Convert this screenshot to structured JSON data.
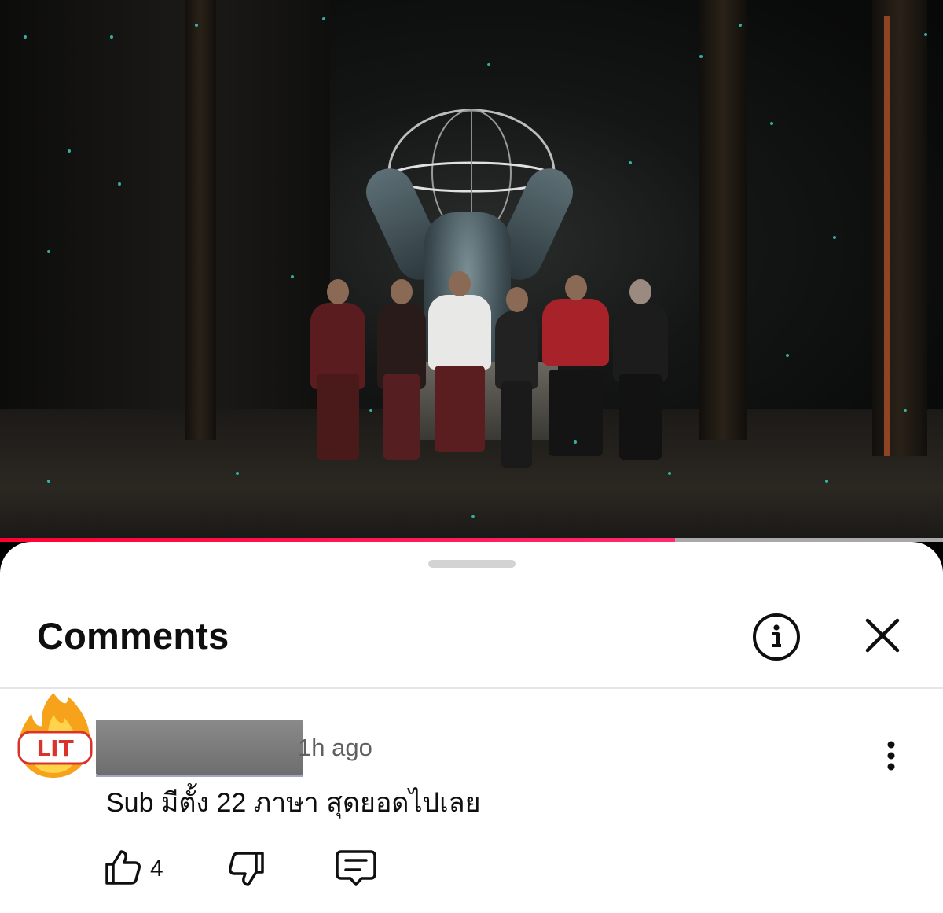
{
  "video": {
    "progress_fraction": 0.716
  },
  "comments_panel": {
    "title": "Comments",
    "info_icon": "info-circle-icon",
    "close_icon": "close-icon"
  },
  "comment": {
    "avatar_badge_text": "LIT",
    "timestamp": "1h ago",
    "text": "Sub มีตั้ง 22 ภาษา สุดยอดไปเลย",
    "like_count": "4",
    "more_icon": "more-vertical-icon",
    "like_icon": "thumbs-up-icon",
    "dislike_icon": "thumbs-down-icon",
    "reply_icon": "reply-icon"
  },
  "colors": {
    "progress": "#ff0033",
    "sheet_bg": "#ffffff",
    "text_primary": "#0f0f0f",
    "text_secondary": "#606060"
  }
}
